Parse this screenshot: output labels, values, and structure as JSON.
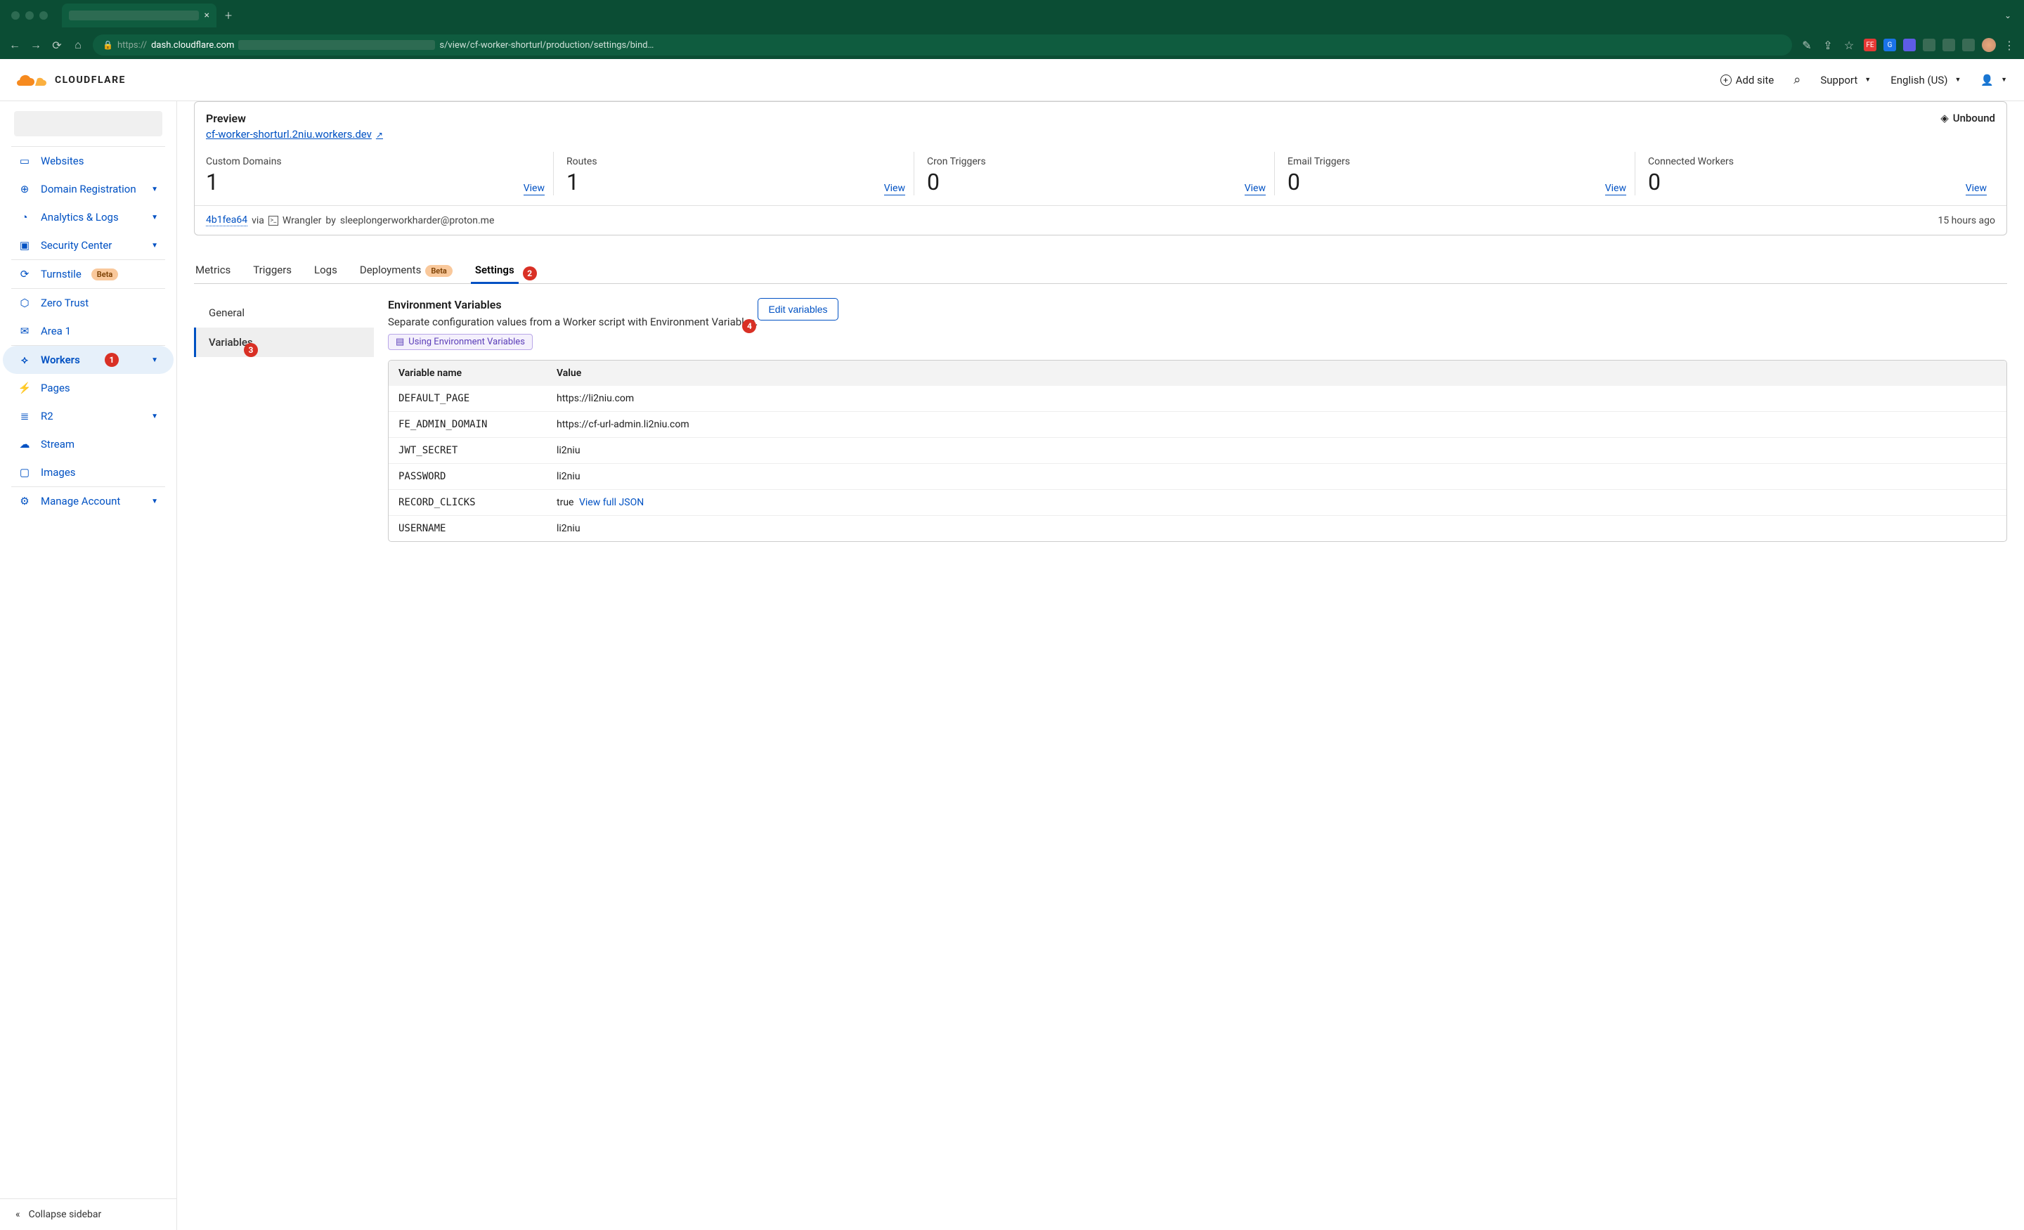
{
  "browser": {
    "url_display_prefix": "https://",
    "url_host": "dash.cloudflare.com",
    "url_path": "s/view/cf-worker-shorturl/production/settings/bind…"
  },
  "header": {
    "add_site": "Add site",
    "support": "Support",
    "language": "English (US)"
  },
  "sidebar": {
    "items": [
      {
        "label": "Websites",
        "icon": "▭"
      },
      {
        "label": "Domain Registration",
        "icon": "⊕",
        "chev": true
      },
      {
        "label": "Analytics & Logs",
        "icon": "◔",
        "chev": true
      },
      {
        "label": "Security Center",
        "icon": "▣",
        "chev": true
      }
    ],
    "items2": [
      {
        "label": "Turnstile",
        "icon": "⟳",
        "beta": true
      }
    ],
    "items3": [
      {
        "label": "Zero Trust",
        "icon": "⬡"
      },
      {
        "label": "Area 1",
        "icon": "✉"
      }
    ],
    "items4": [
      {
        "label": "Workers",
        "icon": "⟡",
        "active": true,
        "chev": true
      },
      {
        "label": "Pages",
        "icon": "⚡"
      },
      {
        "label": "R2",
        "icon": "≣",
        "chev": true
      },
      {
        "label": "Stream",
        "icon": "☁"
      },
      {
        "label": "Images",
        "icon": "▢"
      }
    ],
    "items5": [
      {
        "label": "Manage Account",
        "icon": "⚙",
        "chev": true
      }
    ],
    "collapse": "Collapse sidebar"
  },
  "preview": {
    "title": "Preview",
    "link": "cf-worker-shorturl.2niu.workers.dev",
    "unbound": "Unbound",
    "stats": [
      {
        "label": "Custom Domains",
        "value": "1",
        "action": "View"
      },
      {
        "label": "Routes",
        "value": "1",
        "action": "View"
      },
      {
        "label": "Cron Triggers",
        "value": "0",
        "action": "View"
      },
      {
        "label": "Email Triggers",
        "value": "0",
        "action": "View"
      },
      {
        "label": "Connected Workers",
        "value": "0",
        "action": "View"
      }
    ],
    "deploy": {
      "hash": "4b1fea64",
      "via": "via",
      "tool": "Wrangler",
      "by": "by",
      "email": "sleeplongerworkharder@proton.me",
      "time": "15 hours ago"
    }
  },
  "tabs": [
    "Metrics",
    "Triggers",
    "Logs",
    "Deployments",
    "Settings"
  ],
  "tabs_beta_index": 3,
  "tabs_active_index": 4,
  "settings_nav": [
    {
      "label": "General"
    },
    {
      "label": "Variables",
      "active": true
    }
  ],
  "env": {
    "title": "Environment Variables",
    "desc": "Separate configuration values from a Worker script with Environment Variables.",
    "doc_link": "Using Environment Variables",
    "edit_btn": "Edit variables",
    "col_name": "Variable name",
    "col_value": "Value",
    "view_json": "View full JSON",
    "rows": [
      {
        "name": "DEFAULT_PAGE",
        "value": "https://li2niu.com"
      },
      {
        "name": "FE_ADMIN_DOMAIN",
        "value": "https://cf-url-admin.li2niu.com"
      },
      {
        "name": "JWT_SECRET",
        "value": "li2niu"
      },
      {
        "name": "PASSWORD",
        "value": "li2niu"
      },
      {
        "name": "RECORD_CLICKS",
        "value": "true",
        "json": true
      },
      {
        "name": "USERNAME",
        "value": "li2niu"
      }
    ]
  },
  "annotations": {
    "1": "1",
    "2": "2",
    "3": "3",
    "4": "4"
  },
  "beta_label": "Beta"
}
